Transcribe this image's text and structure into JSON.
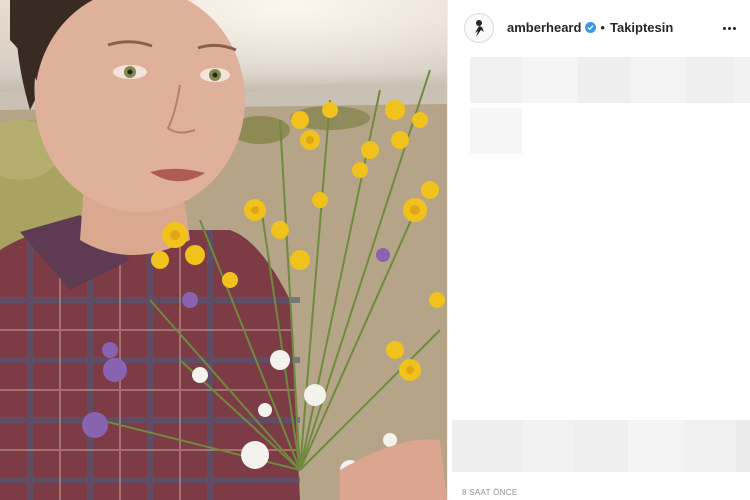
{
  "post": {
    "username": "amberheard",
    "verified": true,
    "separator": "•",
    "follow_status": "Takiptesin",
    "timestamp": "8 SAAT ÖNCE",
    "photo_description_icon": "selfie-with-wildflowers"
  },
  "colors": {
    "verified_badge": "#3897f0",
    "text_primary": "#262626",
    "text_secondary": "#8e8e8e",
    "redacted_block": "#f2f2f2"
  },
  "icons": {
    "avatar": "avatar-icon",
    "verified": "verified-badge-icon",
    "more": "more-options-icon"
  }
}
